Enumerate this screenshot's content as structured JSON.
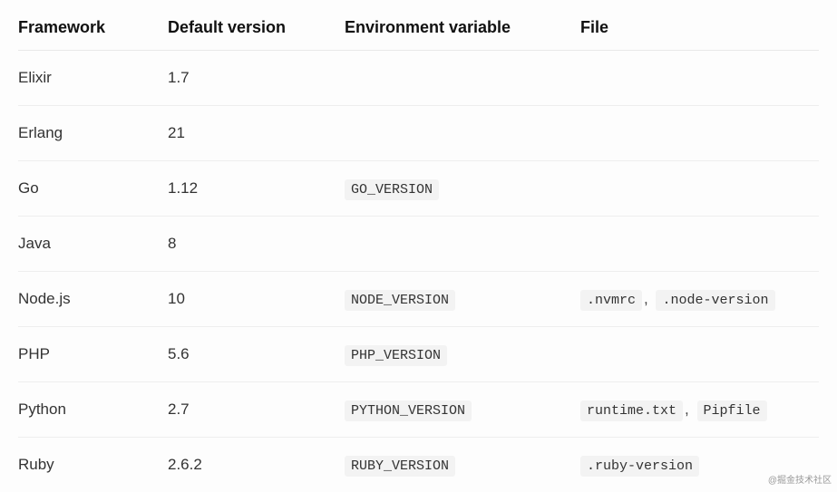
{
  "table": {
    "headers": {
      "framework": "Framework",
      "default_version": "Default version",
      "env_variable": "Environment variable",
      "file": "File"
    },
    "rows": [
      {
        "framework": "Elixir",
        "version": "1.7",
        "env": "",
        "files": []
      },
      {
        "framework": "Erlang",
        "version": "21",
        "env": "",
        "files": []
      },
      {
        "framework": "Go",
        "version": "1.12",
        "env": "GO_VERSION",
        "files": []
      },
      {
        "framework": "Java",
        "version": "8",
        "env": "",
        "files": []
      },
      {
        "framework": "Node.js",
        "version": "10",
        "env": "NODE_VERSION",
        "files": [
          ".nvmrc",
          ".node-version"
        ]
      },
      {
        "framework": "PHP",
        "version": "5.6",
        "env": "PHP_VERSION",
        "files": []
      },
      {
        "framework": "Python",
        "version": "2.7",
        "env": "PYTHON_VERSION",
        "files": [
          "runtime.txt",
          "Pipfile"
        ]
      },
      {
        "framework": "Ruby",
        "version": "2.6.2",
        "env": "RUBY_VERSION",
        "files": [
          ".ruby-version"
        ]
      }
    ]
  },
  "watermark": "@掘金技术社区"
}
